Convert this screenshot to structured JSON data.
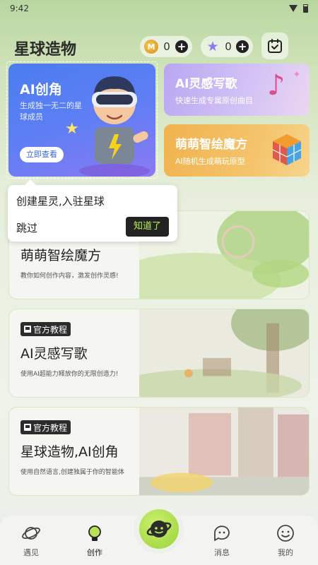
{
  "status": {
    "time": "9:42"
  },
  "header": {
    "title": "星球造物",
    "coins": {
      "icon": "coin-icon",
      "count": "0"
    },
    "stars": {
      "icon": "star-icon",
      "count": "0"
    }
  },
  "cards": {
    "ai_role": {
      "title": "AI创角",
      "subtitle": "生成独一无二的星球成员",
      "button": "立即查看"
    },
    "lyric": {
      "title": "AI灵感写歌",
      "subtitle": "快速生成专属原创曲目"
    },
    "cube": {
      "title": "萌萌智绘魔方",
      "subtitle": "AI随机生成萌玩原型"
    }
  },
  "tooltip": {
    "text": "创建星灵,入驻星球",
    "skip": "跳过",
    "ok": "知道了"
  },
  "tutorials": [
    {
      "badge": "",
      "title": "萌萌智绘魔方",
      "subtitle": "教你如何创作内容，激发创作灵感!"
    },
    {
      "badge": "官方教程",
      "title": "AI灵感写歌",
      "subtitle": "使用AI超能力释放你的无限创造力!"
    },
    {
      "badge": "官方教程",
      "title": "星球造物,AI创角",
      "subtitle": "使用自然语言,创建独属于你的智能体"
    }
  ],
  "nav": {
    "meet": "遇见",
    "create": "创作",
    "messages": "消息",
    "mine": "我的"
  },
  "colors": {
    "accent": "#9bd33a",
    "dark": "#232323",
    "highlight_text": "#b6f24a"
  }
}
